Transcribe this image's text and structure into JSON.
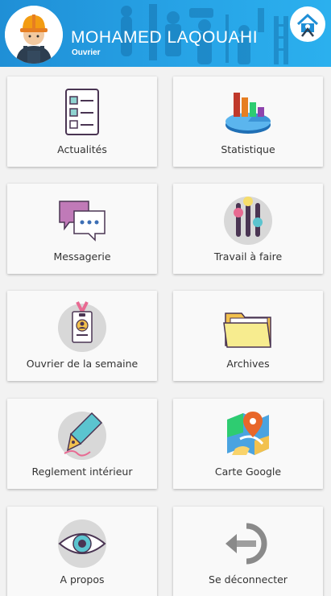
{
  "header": {
    "user_name": "MOHAMED LAQOUAHI",
    "user_role": "Ouvrier",
    "avatar_icon": "worker-avatar-icon",
    "home_icon": "home-icon",
    "brand_color": "#27a3e6"
  },
  "tiles": [
    {
      "label": "Actualités",
      "icon": "checklist-icon"
    },
    {
      "label": "Statistique",
      "icon": "chart-icon"
    },
    {
      "label": "Messagerie",
      "icon": "chat-bubbles-icon"
    },
    {
      "label": "Travail à faire",
      "icon": "sliders-icon"
    },
    {
      "label": "Ouvrier de la semaine",
      "icon": "badge-icon"
    },
    {
      "label": "Archives",
      "icon": "folder-icon"
    },
    {
      "label": "Reglement intérieur",
      "icon": "pen-nib-icon"
    },
    {
      "label": "Carte Google",
      "icon": "map-pin-icon"
    },
    {
      "label": "A propos",
      "icon": "eye-icon"
    },
    {
      "label": "Se déconnecter",
      "icon": "logout-arrow-icon"
    }
  ]
}
